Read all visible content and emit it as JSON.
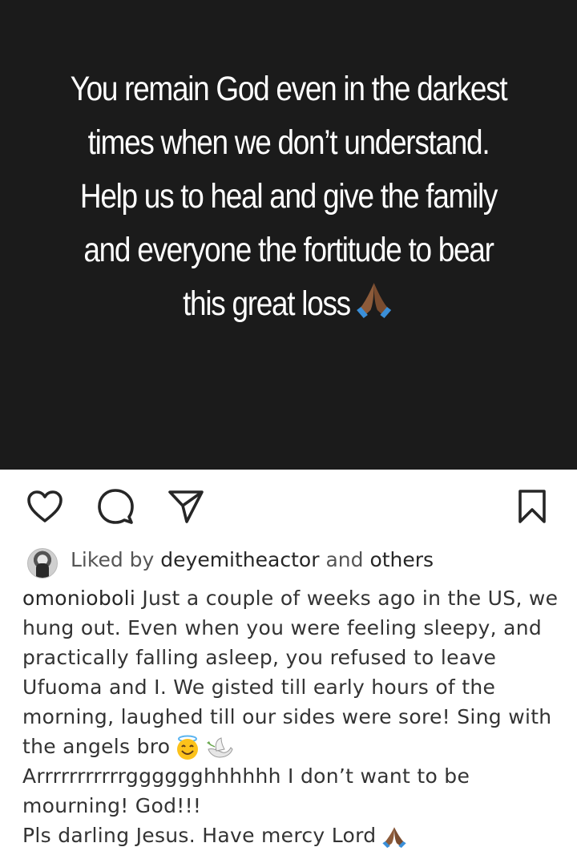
{
  "post": {
    "quote_lines": [
      "You remain God even in the darkest",
      "times when we don’t understand.",
      "Help us to heal and give the family",
      "and everyone the fortitude to bear",
      "this great loss"
    ]
  },
  "actions": {
    "like_icon": "heart-icon",
    "comment_icon": "comment-icon",
    "share_icon": "send-icon",
    "save_icon": "bookmark-icon"
  },
  "likes": {
    "prefix": "Liked by",
    "user": "deyemitheactor",
    "conj": "and",
    "suffix": "others"
  },
  "caption": {
    "username": "omonioboli",
    "lines": [
      " Just a couple of weeks ago in the US, we",
      "hung out. Even when you were feeling sleepy, and",
      "practically falling asleep, you refused to leave",
      "Ufuoma and I. We gisted till early hours of the",
      "morning, laughed till our sides were sore! Sing with",
      "the angels bro",
      "Arrrrrrrrrrrgggggghhhhhh I don’t want to be",
      "mourning! God!!!",
      "Pls darling Jesus. Have mercy Lord"
    ]
  },
  "colors": {
    "image_bg": "#1b1b1b",
    "text": "#262626",
    "emoji_hand": "#8d5b3a",
    "emoji_sleeve": "#3b8fd8"
  }
}
